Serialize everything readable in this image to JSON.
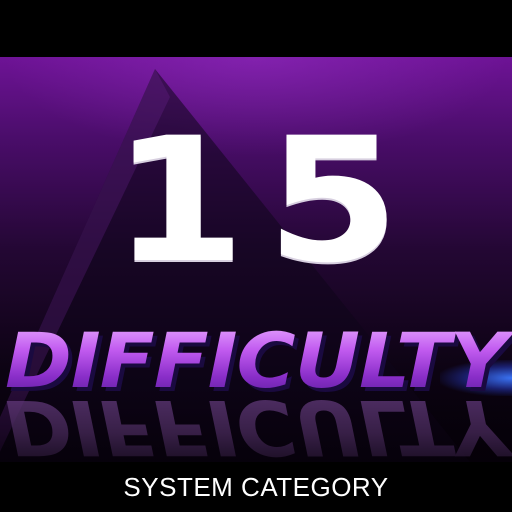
{
  "level": {
    "number": "15"
  },
  "title": {
    "text": "DIFFICULTY",
    "gradient_colors": [
      "#e7a8ff",
      "#c25cf0",
      "#8a2ec9",
      "#5a1f9e"
    ]
  },
  "category": {
    "label": "SYSTEM CATEGORY"
  },
  "theme": {
    "background_top": "#6e1396",
    "background_bottom": "#050008",
    "accent": "#b645e6",
    "streak": "#3c78ff"
  }
}
